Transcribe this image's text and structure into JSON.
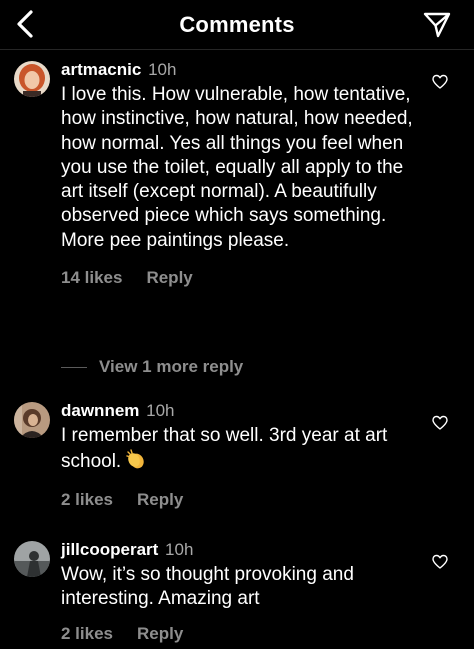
{
  "header": {
    "title": "Comments",
    "back_icon": "chevron-left-icon",
    "send_icon": "paper-plane-icon"
  },
  "comments": [
    {
      "username": "artmacnic",
      "time": "10h",
      "text": "I love this. How vulnerable, how tentative, how instinctive, how natural, how needed, how normal. Yes all things you feel when you use the toilet, equally all apply to the art itself (except normal). A beautifully observed piece which says something. More pee paintings please.",
      "likes": "14 likes",
      "reply": "Reply",
      "view_replies": "View 1 more reply"
    },
    {
      "username": "dawnnem",
      "time": "10h",
      "text": "I remember that so well. 3rd year at art school.",
      "emoji": "clapping-hands-icon",
      "likes": "2 likes",
      "reply": "Reply"
    },
    {
      "username": "jillcooperart",
      "time": "10h",
      "text": "Wow, it’s so thought provoking and interesting. Amazing art",
      "likes": "2 likes",
      "reply": "Reply"
    }
  ],
  "colors": {
    "background": "#000000",
    "muted_text": "#8e8e8e",
    "time_text": "#a8a8a8"
  }
}
